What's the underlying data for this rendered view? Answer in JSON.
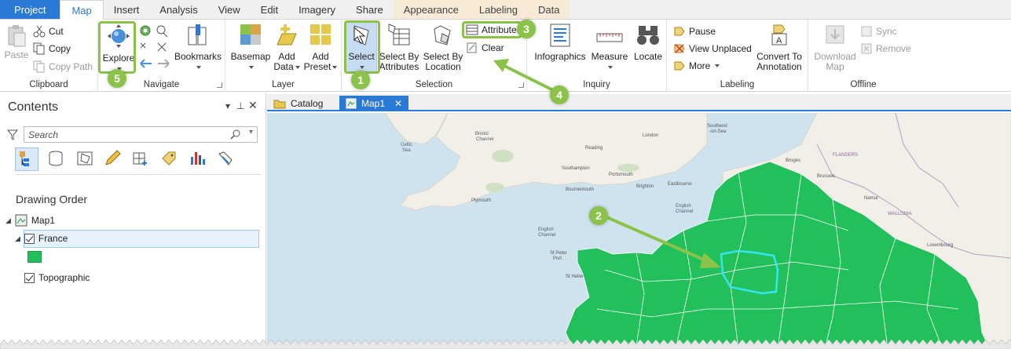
{
  "tabs": {
    "project": "Project",
    "map": "Map",
    "insert": "Insert",
    "analysis": "Analysis",
    "view": "View",
    "edit": "Edit",
    "imagery": "Imagery",
    "share": "Share",
    "appearance": "Appearance",
    "labeling": "Labeling",
    "data": "Data"
  },
  "ribbon": {
    "clipboard": {
      "label": "Clipboard",
      "paste": "Paste",
      "cut": "Cut",
      "copy": "Copy",
      "copy_path": "Copy Path"
    },
    "navigate": {
      "label": "Navigate",
      "explore": "Explore",
      "bookmarks": "Bookmarks"
    },
    "layer": {
      "label": "Layer",
      "basemap": "Basemap",
      "add_data_1": "Add",
      "add_data_2": "Data",
      "add_preset_1": "Add",
      "add_preset_2": "Preset"
    },
    "selection": {
      "label": "Selection",
      "select": "Select",
      "select_by_attr_1": "Select By",
      "select_by_attr_2": "Attributes",
      "select_by_loc_1": "Select By",
      "select_by_loc_2": "Location",
      "attributes": "Attributes",
      "clear": "Clear"
    },
    "inquiry": {
      "label": "Inquiry",
      "infographics": "Infographics",
      "measure": "Measure",
      "locate": "Locate"
    },
    "labeling": {
      "label": "Labeling",
      "pause": "Pause",
      "view_unplaced": "View Unplaced",
      "more": "More",
      "convert_1": "Convert To",
      "convert_2": "Annotation"
    },
    "offline": {
      "label": "Offline",
      "download_1": "Download",
      "download_2": "Map",
      "sync": "Sync",
      "remove": "Remove"
    }
  },
  "callouts": [
    "1",
    "2",
    "3",
    "4",
    "5"
  ],
  "contents": {
    "title": "Contents",
    "search_placeholder": "Search",
    "drawing_order": "Drawing Order",
    "map1": "Map1",
    "france": "France",
    "topographic": "Topographic"
  },
  "view_tabs": {
    "catalog": "Catalog",
    "map1": "Map1"
  },
  "map_labels": {
    "celtic_sea": "Celtic\nSea",
    "bristol": "Bristol\nChannel",
    "london": "London",
    "southend": "Southend\n-on-Sea",
    "reading": "Reading",
    "southampton": "Southampton",
    "bournemouth": "Bournemouth",
    "portsmouth": "Portsmouth",
    "plymouth": "Plymouth",
    "brighton": "Brighton",
    "eastbourne": "Eastbourne",
    "english_channel": "English\nChannel",
    "english_channel_2": "English\nChannel",
    "st_peter": "St Peter\nPort",
    "st_helier": "St Helier",
    "bruxelles": "Brussels",
    "namur": "Namur",
    "luxembourg": "Luxembourg",
    "wallonia": "WALLONIA",
    "flanders": "FLANDERS",
    "bruges": "Bruges"
  },
  "colors": {
    "accent": "#2b79d7",
    "highlight": "#8bc34a",
    "france_fill": "#22c05a",
    "selected_outline": "#33e6f0",
    "sea": "#cfe3ef",
    "land": "#f1efe7"
  }
}
